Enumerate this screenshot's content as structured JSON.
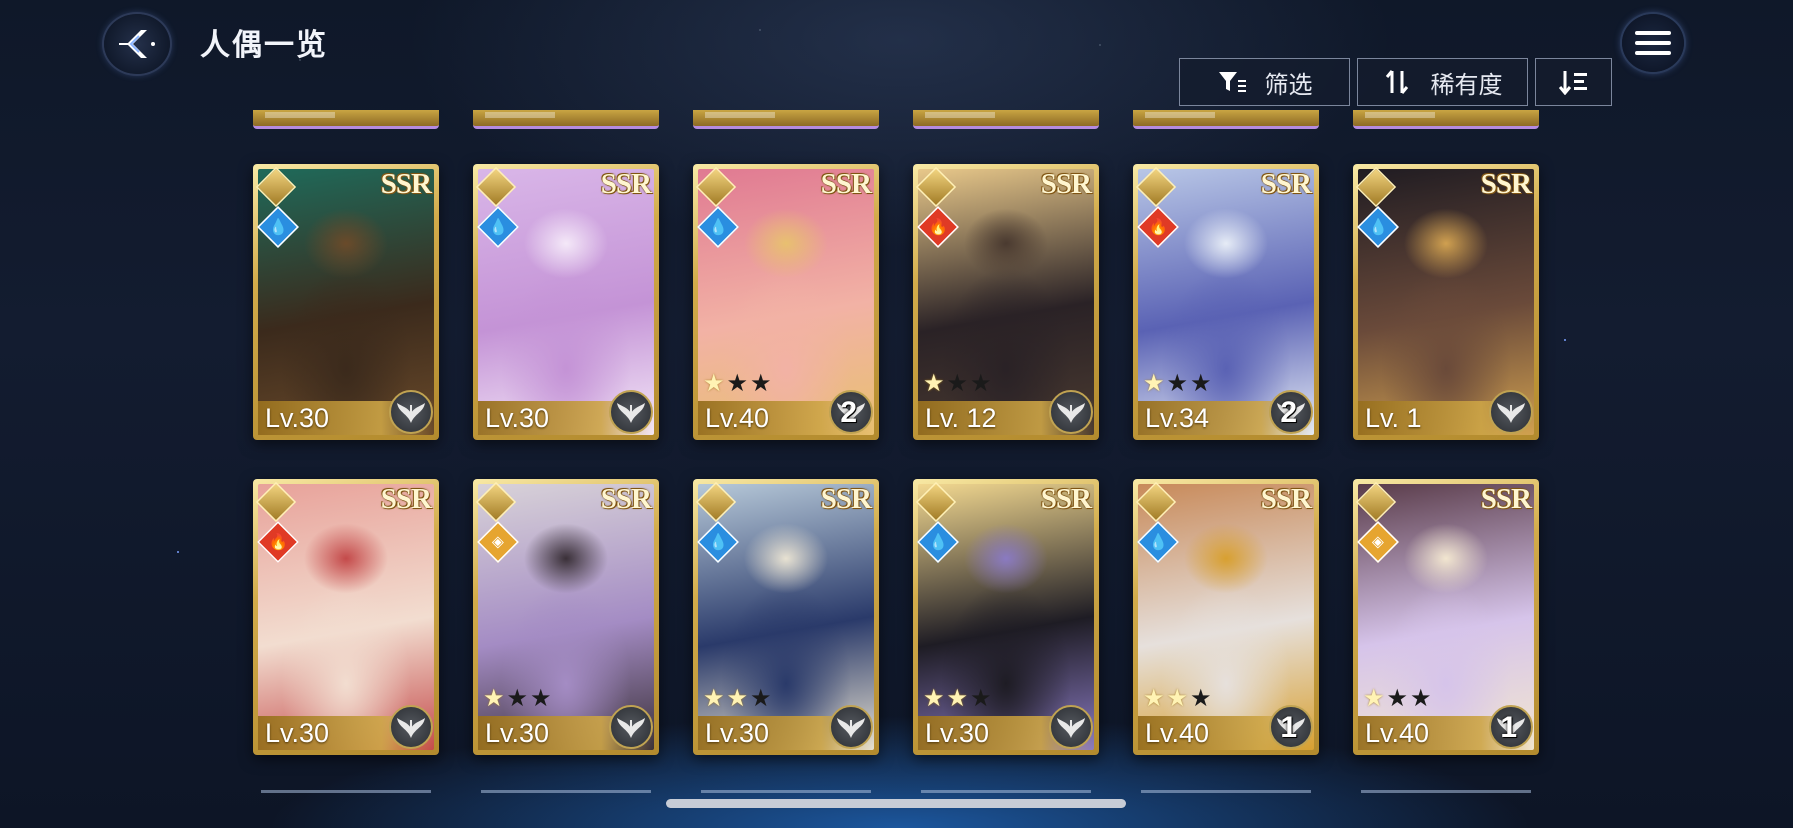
{
  "header": {
    "title": "人偶一览",
    "back_icon": "back-arrow-icon",
    "menu_icon": "hamburger-menu-icon"
  },
  "toolbar": {
    "filter_label": "筛选",
    "rarity_label": "稀有度",
    "filter_icon": "filter-icon",
    "sort_icon": "sort-arrows-icon",
    "order_icon": "sort-order-icon"
  },
  "cards_row1": [
    {
      "rarity": "SSR",
      "element": "water",
      "level": "Lv.30",
      "stars": 0,
      "badge": "",
      "palette": [
        "#1f6a5a",
        "#3b2a1c",
        "#6a4a2a"
      ]
    },
    {
      "rarity": "SSR",
      "element": "water",
      "level": "Lv.30",
      "stars": 0,
      "badge": "",
      "palette": [
        "#d9b6e8",
        "#c493d6",
        "#f4e8f8"
      ]
    },
    {
      "rarity": "SSR",
      "element": "water",
      "level": "Lv.40",
      "stars": 1,
      "badge": "2",
      "palette": [
        "#e07a92",
        "#f2b2a5",
        "#e8c070"
      ]
    },
    {
      "rarity": "SSR",
      "element": "fire",
      "level": "Lv. 12",
      "stars": 1,
      "badge": "",
      "palette": [
        "#e8c88a",
        "#2a2226",
        "#4a3a30"
      ]
    },
    {
      "rarity": "SSR",
      "element": "fire",
      "level": "Lv.34",
      "stars": 1,
      "badge": "2",
      "palette": [
        "#b8c6e6",
        "#5a62b4",
        "#e6ecf6"
      ]
    },
    {
      "rarity": "SSR",
      "element": "water",
      "level": "Lv. 1",
      "stars": 0,
      "badge": "",
      "palette": [
        "#201c22",
        "#6a4a3a",
        "#d0a050"
      ]
    }
  ],
  "cards_row2": [
    {
      "rarity": "SSR",
      "element": "fire",
      "level": "Lv.30",
      "stars": 0,
      "badge": "",
      "palette": [
        "#e8a29a",
        "#f2ddd0",
        "#c44a4a"
      ]
    },
    {
      "rarity": "SSR",
      "element": "light",
      "level": "Lv.30",
      "stars": 1,
      "badge": "",
      "palette": [
        "#d8d2d8",
        "#a48cc4",
        "#3a3038"
      ]
    },
    {
      "rarity": "SSR",
      "element": "water",
      "level": "Lv.30",
      "stars": 2,
      "badge": "",
      "palette": [
        "#b6c8d8",
        "#2a3a6a",
        "#e8e2d2"
      ]
    },
    {
      "rarity": "SSR",
      "element": "water",
      "level": "Lv.30",
      "stars": 2,
      "badge": "",
      "palette": [
        "#f2d890",
        "#1e1c24",
        "#8a7ac2"
      ]
    },
    {
      "rarity": "SSR",
      "element": "water",
      "level": "Lv.40",
      "stars": 2,
      "badge": "1",
      "palette": [
        "#c88a5a",
        "#e6e0dc",
        "#d8a030"
      ]
    },
    {
      "rarity": "SSR",
      "element": "light",
      "level": "Lv.40",
      "stars": 1,
      "badge": "1",
      "palette": [
        "#5a3c4a",
        "#d6c4ea",
        "#f2e6d0"
      ]
    }
  ],
  "star_total": 3,
  "colors": {
    "card_gold": "#d2ab4a",
    "water": "#2a8ee0",
    "fire": "#e03a25",
    "light": "#e6a530"
  }
}
